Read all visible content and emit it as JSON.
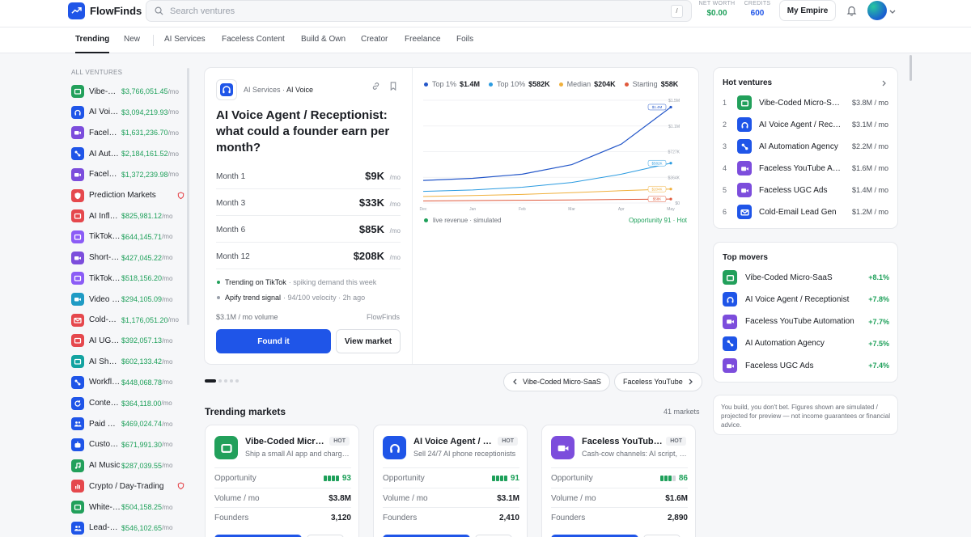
{
  "brand": {
    "name": "FlowFinds"
  },
  "search": {
    "placeholder": "Search ventures",
    "shortcut": "/"
  },
  "stats": {
    "net_worth_label": "NET WORTH",
    "net_worth": "$0.00",
    "credits_label": "CREDITS",
    "credits": "600"
  },
  "header": {
    "empire_button": "My Empire"
  },
  "tabs": [
    {
      "label": "Trending"
    },
    {
      "label": "New"
    },
    {
      "label": "AI Services"
    },
    {
      "label": "Faceless Content"
    },
    {
      "label": "Build & Own"
    },
    {
      "label": "Creator"
    },
    {
      "label": "Freelance"
    },
    {
      "label": "Foils"
    }
  ],
  "sidebar": {
    "title": "ALL VENTURES",
    "items": [
      {
        "name": "Vibe-Coded Micro-SaaS",
        "value": "$3,766,051.45",
        "unit": "/mo",
        "icon": "app-icon",
        "color": "#22a05b"
      },
      {
        "name": "AI Voice Agent",
        "value": "$3,094,219.93",
        "unit": "/mo",
        "icon": "headset-icon",
        "color": "#1f55e8"
      },
      {
        "name": "Faceless YouTube",
        "value": "$1,631,236.70",
        "unit": "/mo",
        "icon": "video-icon",
        "color": "#7c4ddc"
      },
      {
        "name": "AI Automation",
        "value": "$2,184,161.52",
        "unit": "/mo",
        "icon": "workflow-icon",
        "color": "#1f55e8"
      },
      {
        "name": "Faceless UGC",
        "value": "$1,372,239.98",
        "unit": "/mo",
        "icon": "video-icon",
        "color": "#7c4ddc"
      },
      {
        "name": "Prediction Markets",
        "value": "",
        "unit": "",
        "icon": "shield-icon",
        "color": "#e5484d"
      },
      {
        "name": "AI Influencer",
        "value": "$825,981.12",
        "unit": "/mo",
        "icon": "app-icon",
        "color": "#e5484d"
      },
      {
        "name": "TikTok Shop",
        "value": "$644,145.71",
        "unit": "/mo",
        "icon": "app-icon",
        "color": "#8b5cf6"
      },
      {
        "name": "Short-Form",
        "value": "$427,045.22",
        "unit": "/mo",
        "icon": "video-icon",
        "color": "#7c4ddc"
      },
      {
        "name": "TikTok Creator",
        "value": "$518,156.20",
        "unit": "/mo",
        "icon": "app-icon",
        "color": "#8b5cf6"
      },
      {
        "name": "Video Editing",
        "value": "$294,105.09",
        "unit": "/mo",
        "icon": "video-icon",
        "color": "#1f9bc4"
      },
      {
        "name": "Cold-Email",
        "value": "$1,176,051.20",
        "unit": "/mo",
        "icon": "mail-icon",
        "color": "#e5484d"
      },
      {
        "name": "AI UGC Ads",
        "value": "$392,057.13",
        "unit": "/mo",
        "icon": "app-icon",
        "color": "#e5484d"
      },
      {
        "name": "AI Shorts",
        "value": "$602,133.42",
        "unit": "/mo",
        "icon": "app-icon",
        "color": "#13a3a0"
      },
      {
        "name": "Workflow",
        "value": "$448,068.78",
        "unit": "/mo",
        "icon": "workflow-icon",
        "color": "#1f55e8"
      },
      {
        "name": "Content Repurposing",
        "value": "$364,118.00",
        "unit": "/mo",
        "icon": "refresh-icon",
        "color": "#1f55e8"
      },
      {
        "name": "Paid Discord",
        "value": "$469,024.74",
        "unit": "/mo",
        "icon": "users-icon",
        "color": "#1f55e8"
      },
      {
        "name": "Custom GPTs",
        "value": "$671,991.30",
        "unit": "/mo",
        "icon": "bot-icon",
        "color": "#1f55e8"
      },
      {
        "name": "AI Music",
        "value": "$287,039.55",
        "unit": "/mo",
        "icon": "music-icon",
        "color": "#22a05b"
      },
      {
        "name": "Crypto / Day-Trading",
        "value": "",
        "unit": "",
        "icon": "chart-icon",
        "color": "#e5484d"
      },
      {
        "name": "White-Label",
        "value": "$504,158.25",
        "unit": "/mo",
        "icon": "app-icon",
        "color": "#22a05b"
      },
      {
        "name": "Lead-Gen",
        "value": "$546,102.65",
        "unit": "/mo",
        "icon": "users-icon",
        "color": "#1f55e8"
      }
    ]
  },
  "featured": {
    "category": "AI Services",
    "subcategory": "AI Voice",
    "title": "AI Voice Agent / Receptionist: what could a founder earn per month?",
    "months": [
      {
        "label": "Month 1",
        "value": "$9K",
        "unit": "/mo"
      },
      {
        "label": "Month 3",
        "value": "$33K",
        "unit": "/mo"
      },
      {
        "label": "Month 6",
        "value": "$85K",
        "unit": "/mo"
      },
      {
        "label": "Month 12",
        "value": "$208K",
        "unit": "/mo"
      }
    ],
    "signals": [
      {
        "text": "Trending on TikTok",
        "sub": "· spiking demand this week",
        "color": "#22a05b"
      },
      {
        "text": "Apify trend signal",
        "sub": "· 94/100 velocity · 2h ago",
        "color": "#9aa0aa"
      }
    ],
    "volume": "$3.1M / mo volume",
    "source": "FlowFinds",
    "primary_button": "Found it",
    "secondary_button": "View market",
    "legend": [
      {
        "label": "Top 1%",
        "value": "$1.4M",
        "color": "#2457c9"
      },
      {
        "label": "Top 10%",
        "value": "$582K",
        "color": "#2b9be0"
      },
      {
        "label": "Median",
        "value": "$204K",
        "color": "#f0b03c"
      },
      {
        "label": "Starting",
        "value": "$58K",
        "color": "#e0593c"
      }
    ],
    "live_label": "live revenue · simulated",
    "opportunity_label": "Opportunity 91 · Hot"
  },
  "chart_data": {
    "type": "line",
    "x": [
      "Dec",
      "Jan",
      "Feb",
      "Mar",
      "Apr",
      "May"
    ],
    "y_ticks": [
      "$1.5M",
      "$1.1M",
      "$727K",
      "$364K",
      "$0"
    ],
    "ylim": [
      0,
      1500000
    ],
    "series": [
      {
        "name": "Top 1%",
        "end_label": "$1.4M",
        "values": [
          330000,
          360000,
          420000,
          560000,
          860000,
          1400000
        ]
      },
      {
        "name": "Top 10%",
        "end_label": "$582K",
        "values": [
          170000,
          190000,
          230000,
          300000,
          420000,
          582000
        ]
      },
      {
        "name": "Median",
        "end_label": "$204K",
        "values": [
          95000,
          110000,
          125000,
          150000,
          180000,
          204000
        ]
      },
      {
        "name": "Starting",
        "end_label": "$58K",
        "values": [
          30000,
          35000,
          40000,
          45000,
          52000,
          58000
        ]
      }
    ]
  },
  "carousel": {
    "prev_label": "Vibe-Coded Micro-SaaS",
    "next_label": "Faceless YouTube"
  },
  "trending_markets": {
    "title": "Trending markets",
    "count": "41 markets",
    "opportunity_label": "Opportunity",
    "volume_label": "Volume / mo",
    "founders_label": "Founders",
    "hot_label": "HOT",
    "cards": [
      {
        "name": "Vibe-Coded Micro-SaaS",
        "desc": "Ship a small AI app and charge for it",
        "opportunity": "93",
        "level": 1.0,
        "volume": "$3.8M",
        "founders": "3,120",
        "color": "#22a05b",
        "icon": "app-icon"
      },
      {
        "name": "AI Voice Agent / Receptionist",
        "desc": "Sell 24/7 AI phone receptionists",
        "opportunity": "91",
        "level": 1.0,
        "volume": "$3.1M",
        "founders": "2,410",
        "color": "#1f55e8",
        "icon": "headset-icon"
      },
      {
        "name": "Faceless YouTube Automation",
        "desc": "Cash-cow channels: AI script, voice",
        "opportunity": "86",
        "level": 0.75,
        "volume": "$1.6M",
        "founders": "2,890",
        "color": "#7c4ddc",
        "icon": "video-icon"
      }
    ]
  },
  "hot_ventures": {
    "title": "Hot ventures",
    "items": [
      {
        "rank": "1",
        "name": "Vibe-Coded Micro-SaaS",
        "value": "$3.8M / mo",
        "color": "#22a05b",
        "icon": "app-icon"
      },
      {
        "rank": "2",
        "name": "AI Voice Agent / Receptionist",
        "value": "$3.1M / mo",
        "color": "#1f55e8",
        "icon": "headset-icon"
      },
      {
        "rank": "3",
        "name": "AI Automation Agency",
        "value": "$2.2M / mo",
        "color": "#1f55e8",
        "icon": "workflow-icon"
      },
      {
        "rank": "4",
        "name": "Faceless YouTube Automation",
        "value": "$1.6M / mo",
        "color": "#7c4ddc",
        "icon": "video-icon"
      },
      {
        "rank": "5",
        "name": "Faceless UGC Ads",
        "value": "$1.4M / mo",
        "color": "#7c4ddc",
        "icon": "video-icon"
      },
      {
        "rank": "6",
        "name": "Cold-Email Lead Gen",
        "value": "$1.2M / mo",
        "color": "#1f55e8",
        "icon": "mail-icon"
      }
    ]
  },
  "top_movers": {
    "title": "Top movers",
    "items": [
      {
        "name": "Vibe-Coded Micro-SaaS",
        "change": "+8.1%",
        "color": "#22a05b",
        "icon": "app-icon"
      },
      {
        "name": "AI Voice Agent / Receptionist",
        "change": "+7.8%",
        "color": "#1f55e8",
        "icon": "headset-icon"
      },
      {
        "name": "Faceless YouTube Automation",
        "change": "+7.7%",
        "color": "#7c4ddc",
        "icon": "video-icon"
      },
      {
        "name": "AI Automation Agency",
        "change": "+7.5%",
        "color": "#1f55e8",
        "icon": "workflow-icon"
      },
      {
        "name": "Faceless UGC Ads",
        "change": "+7.4%",
        "color": "#7c4ddc",
        "icon": "video-icon"
      }
    ]
  },
  "disclaimer": "You build, you don't bet. Figures shown are simulated / projected for preview — not income guarantees or financial advice."
}
